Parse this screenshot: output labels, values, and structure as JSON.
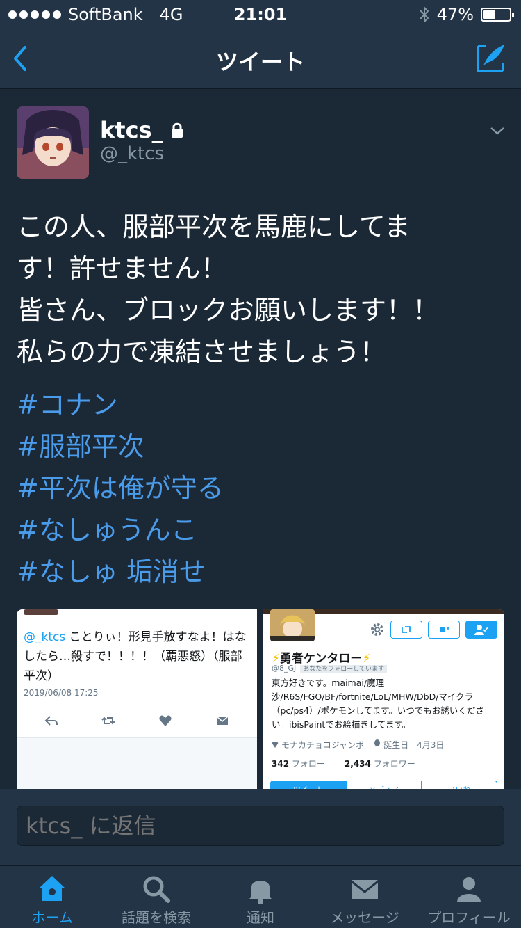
{
  "status_bar": {
    "carrier": "SoftBank",
    "network": "4G",
    "time": "21:01",
    "battery": "47%",
    "battery_level": 0.47
  },
  "nav": {
    "title": "ツイート"
  },
  "tweet": {
    "display_name": "ktcs_",
    "handle": "@_ktcs",
    "text_lines": [
      "この人、服部平次を馬鹿にしてま",
      "す！許せません！",
      "皆さん、ブロックお願いします！！",
      "私らの力で凍結させましょう！"
    ],
    "hashtags": [
      "#コナン",
      "#服部平次",
      "#平次は俺が守る",
      "#なしゅうんこ",
      "#なしゅ 垢消せ"
    ]
  },
  "media_left": {
    "mention": "@_ktcs",
    "text": " ことりぃ！形見手放すなよ！はなしたら…殺すで！！！！（覇悪怒）（服部平次）",
    "date": "2019/06/08 17:25"
  },
  "media_right": {
    "name": "勇者ケンタロー",
    "bolt": "⚡",
    "handle": "@8_GJ",
    "follows_you": "あなたをフォローしています",
    "bio": "東方好きです。maimai/魔理沙/R6S/FGO/BF/fortnite/LoL/MHW/DbD/マイクラ（pc/ps4）/ポケモンしてます。いつでもお誘いください。ibisPaintでお絵描きしてます。",
    "location": "モナカチョコジャンボ",
    "birthday": "誕生日　4月3日",
    "following_count": "342",
    "following_label": "フォロー",
    "followers_count": "2,434",
    "followers_label": "フォロワー",
    "tabs": [
      "ツイート",
      "メディア",
      "いいね"
    ]
  },
  "reply": {
    "placeholder": "ktcs_ に返信"
  },
  "tab_bar": {
    "items": [
      {
        "label": "ホーム"
      },
      {
        "label": "話題を検索"
      },
      {
        "label": "通知"
      },
      {
        "label": "メッセージ"
      },
      {
        "label": "プロフィール"
      }
    ]
  },
  "colors": {
    "background": "#1b2836",
    "bar": "#243447",
    "accent": "#1da1f2",
    "hashtag": "#4a9be9",
    "muted": "#8899a6"
  }
}
